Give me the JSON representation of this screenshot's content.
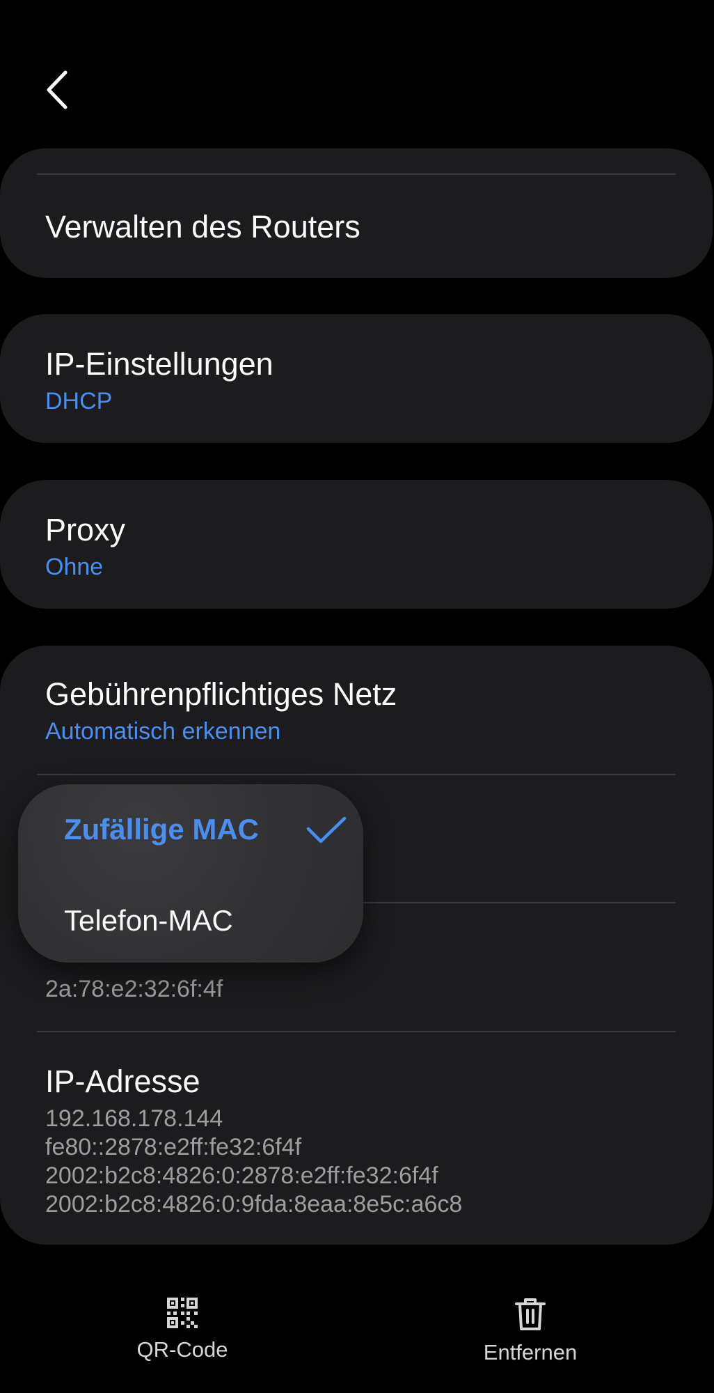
{
  "header": {
    "back_icon": "chevron-left-icon"
  },
  "router_card": {
    "title": "Verwalten des Routers"
  },
  "ip_settings": {
    "title": "IP-Einstellungen",
    "value": "DHCP"
  },
  "proxy": {
    "title": "Proxy",
    "value": "Ohne"
  },
  "network_card": {
    "metered": {
      "title": "Gebührenpflichtiges Netz",
      "value": "Automatisch erkennen"
    },
    "mac_address": {
      "value": "2a:78:e2:32:6f:4f"
    },
    "ip_address": {
      "title": "IP-Adresse",
      "lines": [
        "192.168.178.144",
        "fe80::2878:e2ff:fe32:6f4f",
        "2002:b2c8:4826:0:2878:e2ff:fe32:6f4f",
        "2002:b2c8:4826:0:9fda:8eaa:8e5c:a6c8"
      ]
    }
  },
  "mac_popup": {
    "options": [
      {
        "label": "Zufällige MAC",
        "selected": true
      },
      {
        "label": "Telefon-MAC",
        "selected": false
      }
    ]
  },
  "bottom_bar": {
    "qr": {
      "label": "QR-Code",
      "icon": "qr-code-icon"
    },
    "remove": {
      "label": "Entfernen",
      "icon": "trash-icon"
    }
  },
  "colors": {
    "accent": "#4a8ff0",
    "card": "#1c1c1e",
    "background": "#000000",
    "popup": "#353538"
  }
}
